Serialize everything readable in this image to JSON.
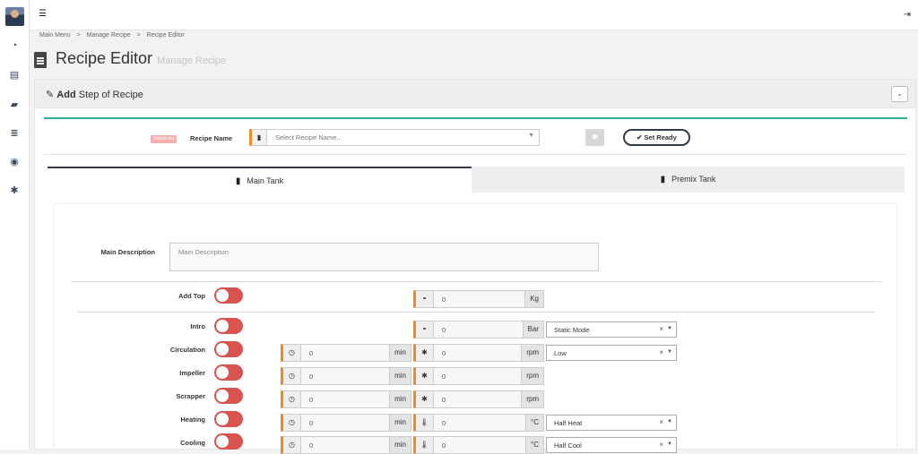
{
  "breadcrumb": [
    "Main Menu",
    ">",
    "Manage Recipe",
    ">",
    "Recipe Editor"
  ],
  "page": {
    "title": "Recipe Editor",
    "subtitle": "Manage Recipe"
  },
  "panel": {
    "title_bold": "Add",
    "title_rest": "Step of Recipe"
  },
  "recipe": {
    "badge": "Dolumi ley",
    "name_label": "Recipe Name",
    "select_placeholder": "Select Recipe Name...",
    "set_ready_label": "Set Ready"
  },
  "tabs": [
    {
      "label": "Main Tank",
      "icon": "1",
      "active": true
    },
    {
      "label": "Premix Tank",
      "icon": "2",
      "active": false
    }
  ],
  "description": {
    "label": "Main Description",
    "placeholder": "Main Description"
  },
  "rows": [
    {
      "label": "Add Top",
      "kg_value": "0",
      "kg_unit": "Kg"
    },
    {
      "label": "Intro",
      "bar_value": "0",
      "bar_unit": "Bar",
      "mode": "Static Mode"
    },
    {
      "label": "Circulation",
      "min_value": "0",
      "min_unit": "min",
      "rpm_value": "0",
      "rpm_unit": "rpm",
      "mode": "Low"
    },
    {
      "label": "Impeller",
      "min_value": "0",
      "min_unit": "min",
      "rpm_value": "0",
      "rpm_unit": "rpm"
    },
    {
      "label": "Scrapper",
      "min_value": "0",
      "min_unit": "min",
      "rpm_value": "0",
      "rpm_unit": "rpm"
    },
    {
      "label": "Heating",
      "min_value": "0",
      "min_unit": "min",
      "temp_value": "0",
      "temp_unit": "°C",
      "mode": "Half Heat"
    },
    {
      "label": "Cooling",
      "min_value": "0",
      "min_unit": "min",
      "temp_value": "0",
      "temp_unit": "°C",
      "mode": "Half Cool"
    }
  ],
  "glyphs": {
    "close": "×",
    "arrow": "▼"
  }
}
